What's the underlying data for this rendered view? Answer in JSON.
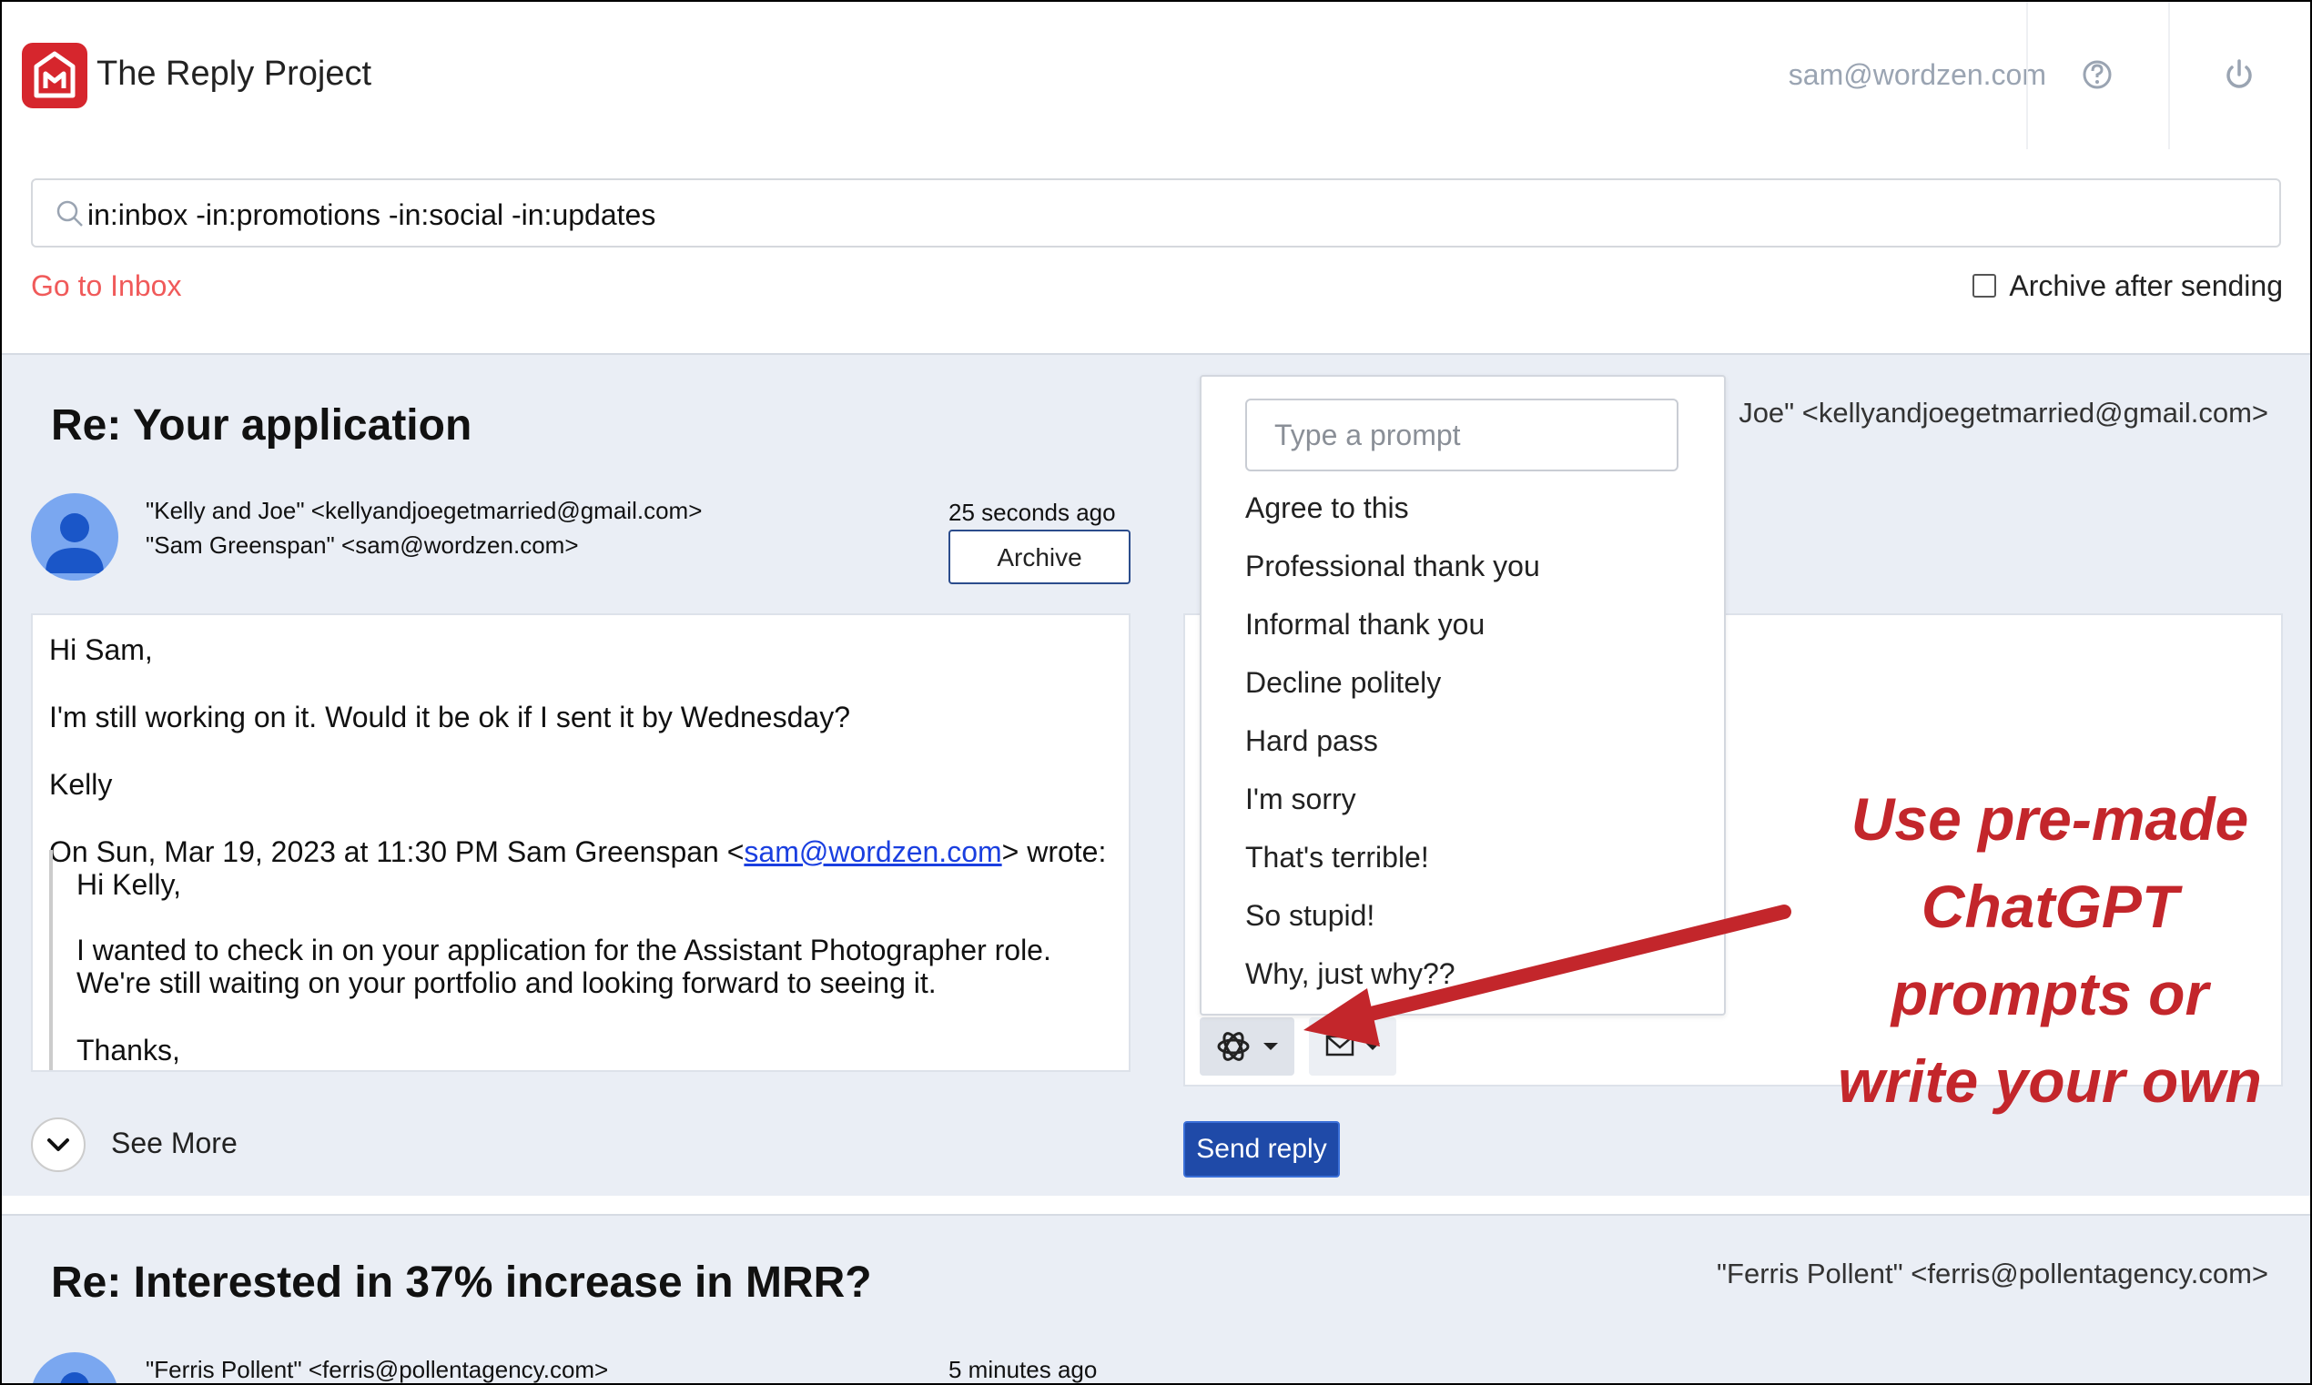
{
  "header": {
    "app_title": "The Reply Project",
    "user_email": "sam@wordzen.com",
    "icons": [
      "help-icon",
      "power-icon"
    ]
  },
  "search": {
    "value": "in:inbox -in:promotions -in:social -in:updates",
    "icon": "search-icon"
  },
  "nav": {
    "go_to_inbox": "Go to Inbox",
    "archive_after_sending": "Archive after sending"
  },
  "thread1": {
    "subject": "Re: Your application",
    "from": "\"Kelly and Joe\" <kellyandjoegetmarried@gmail.com>",
    "to": "\"Sam Greenspan\" <sam@wordzen.com>",
    "to_right_partial": "Joe\" <kellyandjoegetmarried@gmail.com>",
    "timestamp": "25 seconds ago",
    "archive_label": "Archive",
    "body": {
      "greeting": "Hi Sam,",
      "line1": "I'm still working on it. Would it be ok if I sent it by Wednesday?",
      "signoff": "Kelly",
      "quote_header_pre": "On Sun, Mar 19, 2023 at 11:30 PM Sam Greenspan <",
      "quote_header_link": "sam@wordzen.com",
      "quote_header_post": "> wrote:",
      "quote_greeting": "Hi Kelly,",
      "quote_line1": "I wanted to check in on your application for the Assistant Photographer role.",
      "quote_line2": "We're still waiting on your portfolio and looking forward to seeing it.",
      "quote_thanks": "Thanks,"
    },
    "see_more": "See More",
    "send_reply": "Send reply"
  },
  "prompt_menu": {
    "placeholder": "Type a prompt",
    "items": [
      "Agree to this",
      "Professional thank you",
      "Informal thank you",
      "Decline politely",
      "Hard pass",
      "I'm sorry",
      "That's terrible!",
      "So stupid!",
      "Why, just why??"
    ]
  },
  "toolbar_icons": [
    "openai-icon",
    "mail-icon"
  ],
  "thread2": {
    "subject": "Re: Interested in 37% increase in MRR?",
    "to_right": "\"Ferris Pollent\" <ferris@pollentagency.com>",
    "from": "\"Ferris Pollent\" <ferris@pollentagency.com>",
    "timestamp": "5 minutes ago"
  },
  "annotation": {
    "line1": "Use pre-made",
    "line2": "ChatGPT prompts or",
    "line3": "write your own",
    "color": "#c3262b"
  },
  "colors": {
    "brand": "#d6262d",
    "link_red": "#f05a5a",
    "send_button": "#1f4aa8",
    "panel_bg": "#eaeef5"
  }
}
